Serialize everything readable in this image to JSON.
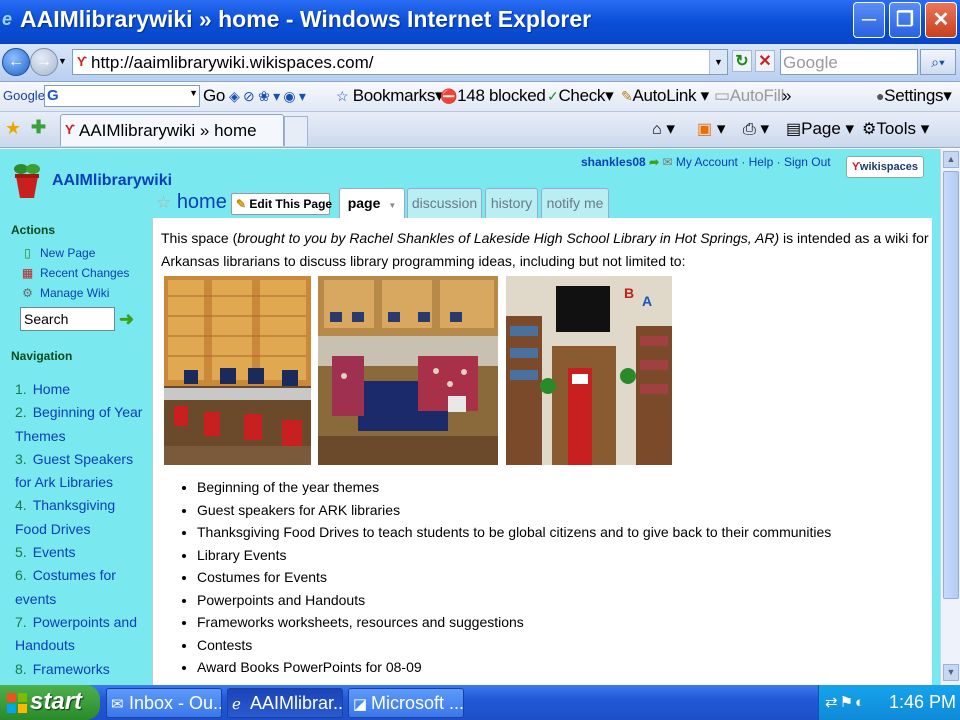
{
  "window": {
    "title": "AAIMlibrarywiki » home - Windows Internet Explorer",
    "min_label": "─",
    "max_label": "❐",
    "close_label": "✕"
  },
  "address": {
    "url": "http://aaimlibrarywiki.wikispaces.com/",
    "search_placeholder": "Google"
  },
  "google_toolbar": {
    "label": "Google",
    "go": "Go",
    "bookmarks": "Bookmarks",
    "blocked": "148 blocked",
    "check": "Check",
    "autolink": "AutoLink",
    "autofill": "AutoFill",
    "more": "»",
    "settings": "Settings"
  },
  "tabs": {
    "current": "AAIMlibrarywiki » home"
  },
  "command_bar": {
    "page": "Page",
    "tools": "Tools"
  },
  "wiki": {
    "name": "AAIMlibrarywiki",
    "user": "shankles08",
    "links": [
      "My Account",
      "Help",
      "Sign Out"
    ],
    "badge": "wikispaces",
    "page_title": "home",
    "edit_button": "Edit This Page",
    "page_tabs": [
      "page",
      "discussion",
      "history",
      "notify me"
    ],
    "actions_heading": "Actions",
    "actions": [
      "New Page",
      "Recent Changes",
      "Manage Wiki"
    ],
    "search_value": "Search",
    "navigation_heading": "Navigation",
    "navigation": [
      {
        "num": "1.",
        "label": "Home"
      },
      {
        "num": "2.",
        "label": "Beginning of Year Themes"
      },
      {
        "num": "3.",
        "label": "Guest Speakers for Ark Libraries"
      },
      {
        "num": "4.",
        "label": "Thanksgiving Food Drives"
      },
      {
        "num": "5.",
        "label": "Events"
      },
      {
        "num": "6.",
        "label": "Costumes for events"
      },
      {
        "num": "7.",
        "label": "Powerpoints and Handouts"
      },
      {
        "num": "8.",
        "label": "Frameworks Resources"
      }
    ],
    "intro_before": "This space (",
    "intro_italic": "brought to you by Rachel Shankles of Lakeside High School Library in Hot Springs, AR)",
    "intro_after": " is intended as a wiki for Arkansas librarians to discuss library programming ideas, including but not limited to:",
    "bullets": [
      "Beginning of the year themes",
      "Guest speakers for ARK libraries",
      "Thanksgiving Food Drives to teach students to be global citizens and to give back to their communities",
      "Library Events",
      "Costumes for Events",
      "Powerpoints and Handouts",
      "Frameworks worksheets, resources and suggestions",
      "Contests",
      "Award Books PowerPoints for 08-09"
    ]
  },
  "taskbar": {
    "start": "start",
    "items": [
      "Inbox - Ou...",
      "AAIMlibrar...",
      "Microsoft ..."
    ],
    "clock": "1:46 PM"
  }
}
